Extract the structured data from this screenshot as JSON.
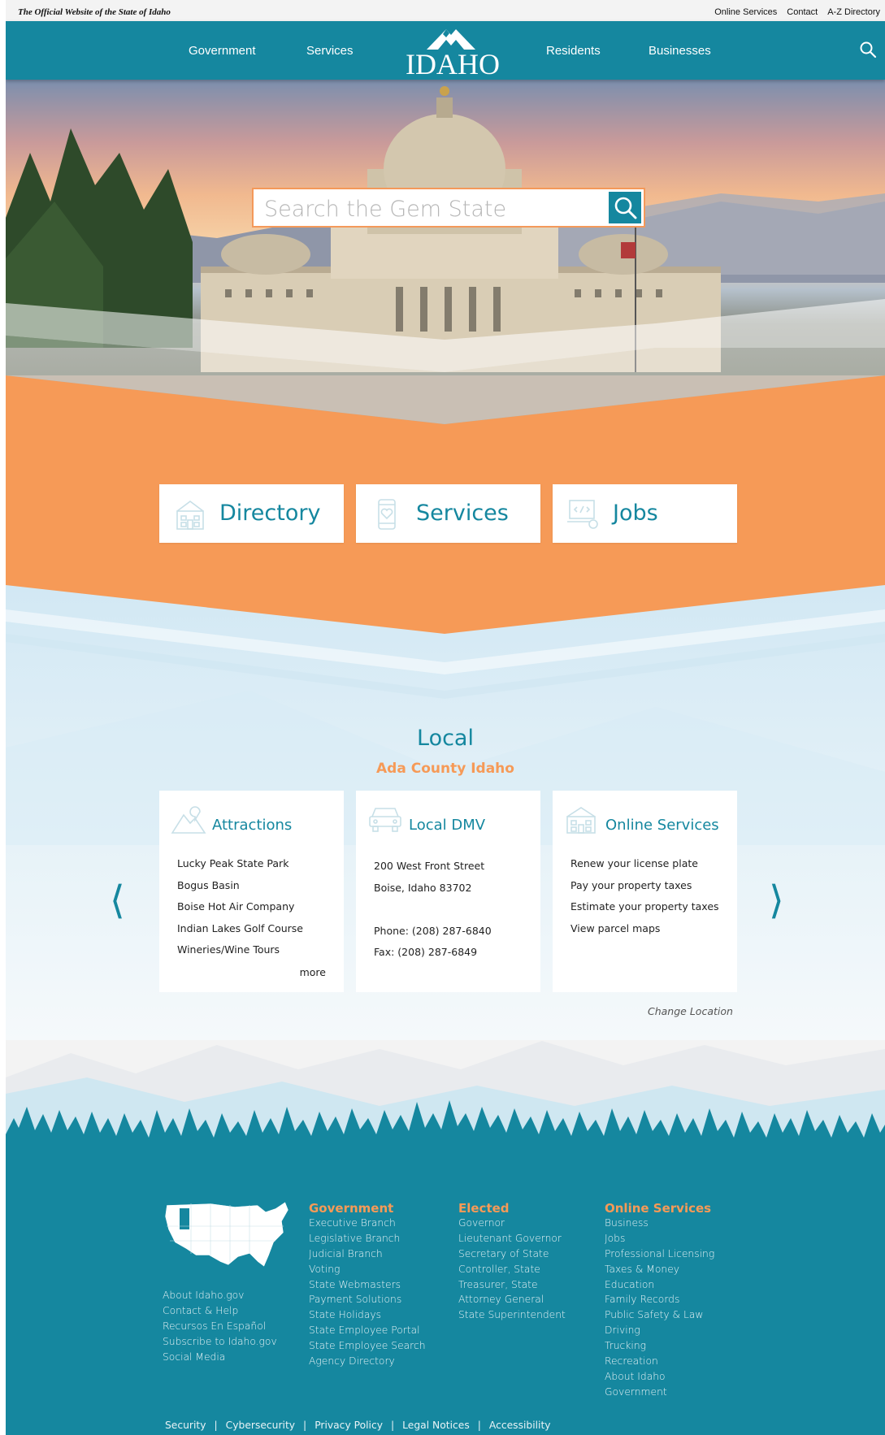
{
  "utility": {
    "official": "The Official Website of the State of Idaho",
    "links": [
      "Online Services",
      "Contact",
      "A-Z Directory"
    ]
  },
  "nav": {
    "items": [
      "Government",
      "Services",
      "Residents",
      "Businesses"
    ],
    "logo_text": "IDAHO"
  },
  "hero": {
    "search_placeholder": "Search the Gem State"
  },
  "quick_links": [
    {
      "label": "Directory",
      "icon": "building-icon"
    },
    {
      "label": "Services",
      "icon": "mobile-icon"
    },
    {
      "label": "Jobs",
      "icon": "code-laptop-icon"
    }
  ],
  "local": {
    "title": "Local",
    "subtitle": "Ada County Idaho",
    "cards": {
      "attractions": {
        "title": "Attractions",
        "items": [
          "Lucky Peak State Park",
          "Bogus Basin",
          "Boise Hot Air Company",
          "Indian Lakes Golf Course",
          "Wineries/Wine Tours"
        ],
        "more": "more"
      },
      "dmv": {
        "title": "Local DMV",
        "address1": "200 West Front Street",
        "address2": "Boise, Idaho 83702",
        "phone": "Phone: (208) 287-6840",
        "fax": "Fax: (208) 287-6849"
      },
      "online": {
        "title": "Online Services",
        "items": [
          "Renew your license plate",
          "Pay your property taxes",
          "Estimate your property taxes",
          "View parcel maps"
        ]
      }
    },
    "prev": "⟨",
    "next": "⟩",
    "change_location": "Change Location"
  },
  "footer": {
    "left_links": [
      "About Idaho.gov",
      "Contact & Help",
      "Recursos En Español",
      "Subscribe to Idaho.gov",
      "Social Media"
    ],
    "government": {
      "heading": "Government",
      "links": [
        "Executive Branch",
        "Legislative Branch",
        "Judicial Branch",
        "Voting",
        "State Webmasters",
        "Payment Solutions",
        "State Holidays",
        "State Employee Portal",
        "State Employee Search",
        "Agency Directory"
      ]
    },
    "elected": {
      "heading": "Elected",
      "links": [
        "Governor",
        "Lieutenant Governor",
        "Secretary of State",
        "Controller, State",
        "Treasurer, State",
        "Attorney General",
        "State Superintendent"
      ]
    },
    "online_services": {
      "heading": "Online Services",
      "links": [
        "Business",
        "Jobs",
        "Professional Licensing",
        "Taxes & Money",
        "Education",
        "Family Records",
        "Public Safety & Law",
        "Driving",
        "Trucking",
        "Recreation",
        "About Idaho",
        "Government"
      ]
    },
    "bottom_links": [
      "Security",
      "Cybersecurity",
      "Privacy Policy",
      "Legal Notices",
      "Accessibility"
    ]
  },
  "colors": {
    "teal": "#15879f",
    "orange": "#f69a57",
    "light_blue": "#dcedf6"
  }
}
